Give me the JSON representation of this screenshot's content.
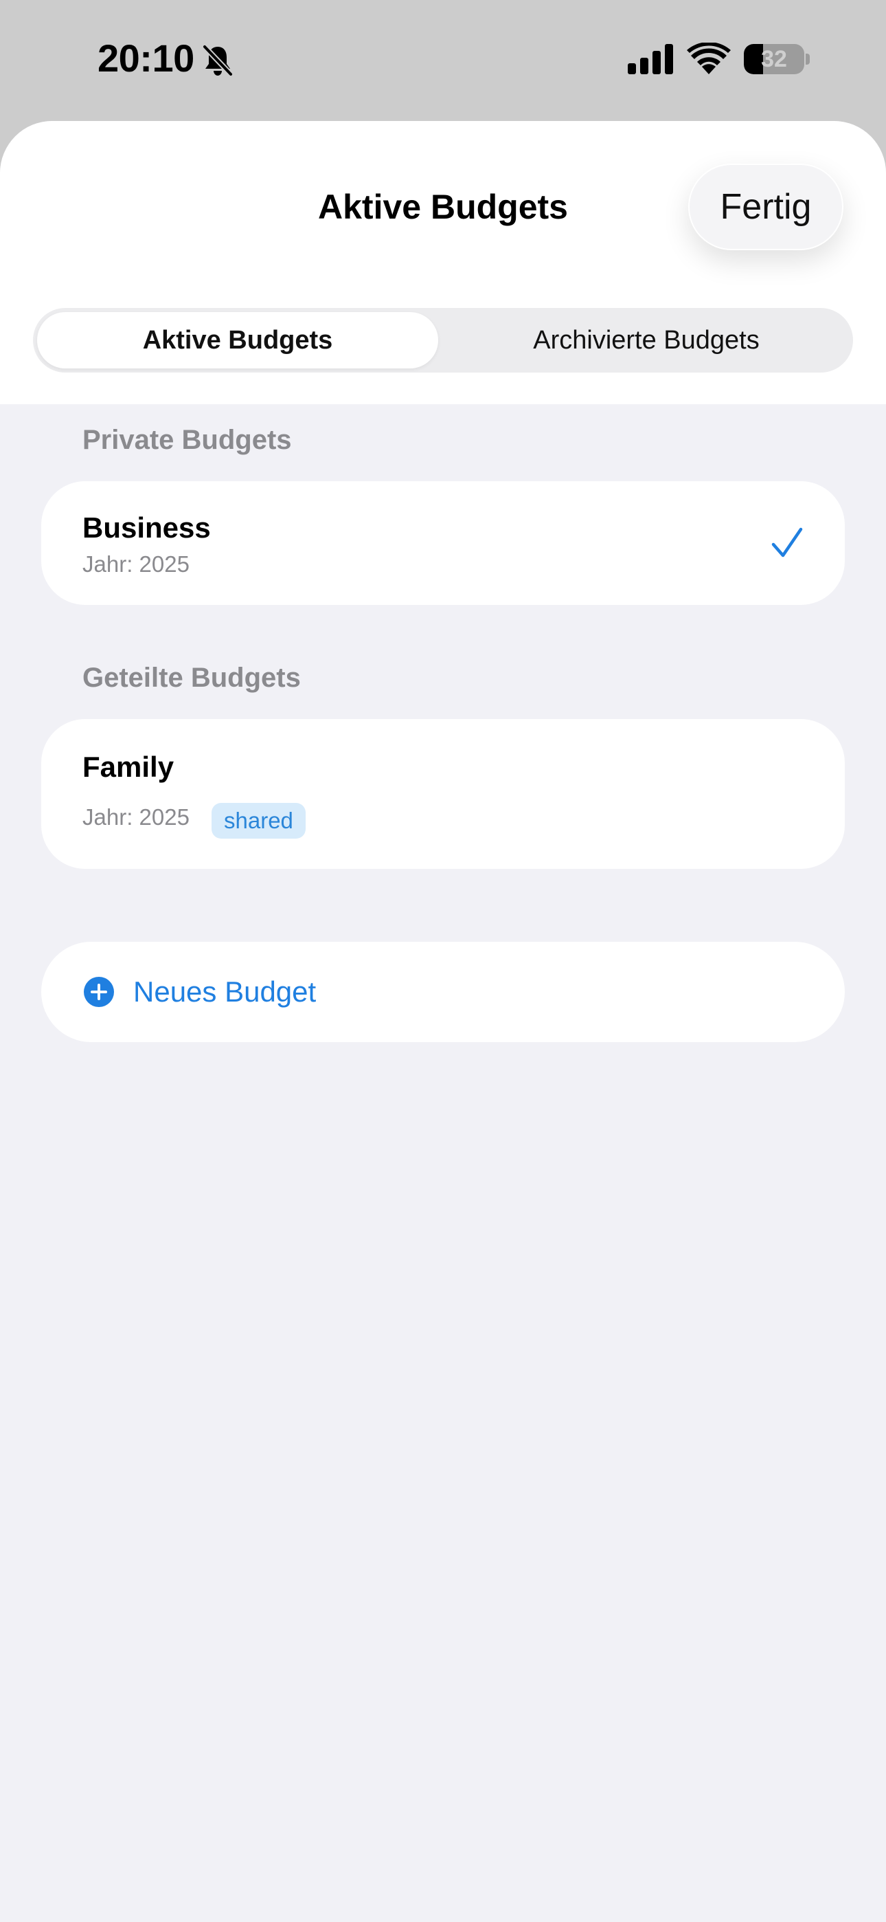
{
  "status_bar": {
    "time": "20:10",
    "battery_level": "32",
    "battery_fraction": 0.32,
    "icons": [
      "bell-slash-icon",
      "signal-icon",
      "wifi-icon",
      "battery-icon"
    ]
  },
  "sheet": {
    "title": "Aktive Budgets",
    "done_label": "Fertig"
  },
  "tabs": [
    {
      "label": "Aktive Budgets",
      "selected": true
    },
    {
      "label": "Archivierte Budgets",
      "selected": false
    }
  ],
  "sections": [
    {
      "label": "Private Budgets",
      "items": [
        {
          "title": "Business",
          "subtitle": "Jahr: 2025",
          "selected": true
        }
      ]
    },
    {
      "label": "Geteilte Budgets",
      "items": [
        {
          "title": "Family",
          "subtitle": "Jahr: 2025",
          "badge": "shared",
          "selected": false
        }
      ]
    }
  ],
  "new_budget": {
    "label": "Neues Budget",
    "icon": "plus-circle-icon"
  },
  "colors": {
    "accent": "#1f7fe0",
    "badge_background": "#d7ebfb",
    "secondary_text": "#8a8a8e",
    "background": "#f1f1f6"
  }
}
